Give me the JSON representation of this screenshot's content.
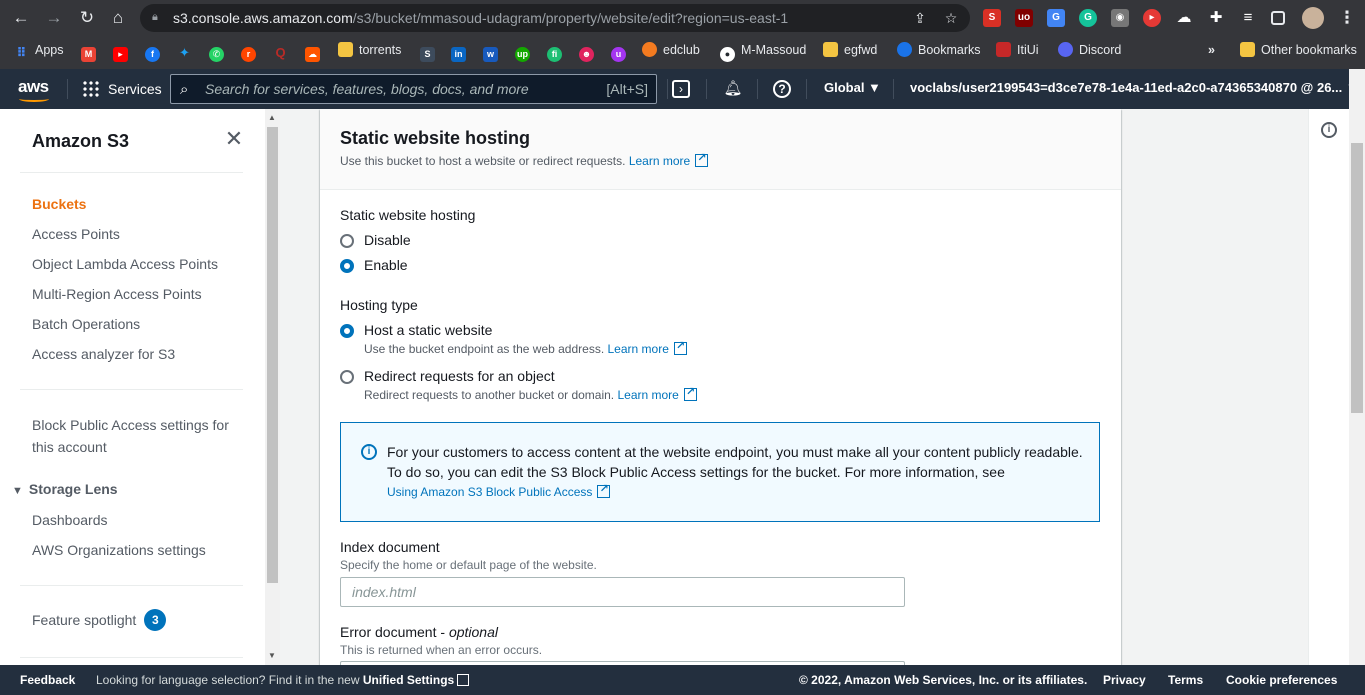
{
  "browser": {
    "url_host": "s3.console.aws.amazon.com",
    "url_path": "/s3/bucket/mmasoud-udagram/property/website/edit?region=us-east-1",
    "bookmarks": [
      {
        "label": "Apps",
        "color": "#4285f4"
      },
      {
        "label": "torrents",
        "color": "#f4c542"
      },
      {
        "label": "edclub",
        "color": "#f47b20"
      },
      {
        "label": "M-Massoud",
        "color": "#24292e"
      },
      {
        "label": "egfwd",
        "color": "#f4c542"
      },
      {
        "label": "Bookmarks",
        "color": "#1a73e8"
      },
      {
        "label": "ItiUi",
        "color": "#c62828"
      },
      {
        "label": "Discord",
        "color": "#5865f2"
      },
      {
        "label": "Other bookmarks",
        "color": "#f4c542"
      }
    ],
    "overflow": "»"
  },
  "awsnav": {
    "logo": "aws",
    "services": "Services",
    "search_placeholder": "Search for services, features, blogs, docs, and more",
    "search_shortcut": "[Alt+S]",
    "region": "Global ▼",
    "account": "voclabs/user2199543=d3ce7e78-1e4a-11ed-a2c0-a74365340870 @ 26... ▼"
  },
  "sidebar": {
    "title": "Amazon S3",
    "items": [
      "Buckets",
      "Access Points",
      "Object Lambda Access Points",
      "Multi-Region Access Points",
      "Batch Operations",
      "Access analyzer for S3"
    ],
    "block_public_line1": "Block Public Access settings for",
    "block_public_line2": "this account",
    "storage_lens": "Storage Lens",
    "storage_items": [
      "Dashboards",
      "AWS Organizations settings"
    ],
    "feature_spotlight": "Feature spotlight",
    "feature_count": "3"
  },
  "panel": {
    "title": "Static website hosting",
    "description": "Use this bucket to host a website or redirect requests.",
    "learn_more": "Learn more",
    "hosting_label": "Static website hosting",
    "hosting_options": [
      "Disable",
      "Enable"
    ],
    "hosting_selected": "Enable",
    "type_label": "Hosting type",
    "type_options": [
      {
        "label": "Host a static website",
        "desc": "Use the bucket endpoint as the web address."
      },
      {
        "label": "Redirect requests for an object",
        "desc": "Redirect requests to another bucket or domain."
      }
    ],
    "type_selected": "Host a static website",
    "info_message": "For your customers to access content at the website endpoint, you must make all your content publicly readable. To do so, you can edit the S3 Block Public Access settings for the bucket. For more information, see",
    "info_link": "Using Amazon S3 Block Public Access",
    "index_label": "Index document",
    "index_desc": "Specify the home or default page of the website.",
    "index_placeholder": "index.html",
    "error_label": "Error document -",
    "error_optional": "optional",
    "error_desc": "This is returned when an error occurs."
  },
  "footer": {
    "feedback": "Feedback",
    "lang_text": "Looking for language selection? Find it in the new",
    "lang_link": "Unified Settings",
    "copyright": "© 2022, Amazon Web Services, Inc. or its affiliates.",
    "privacy": "Privacy",
    "terms": "Terms",
    "cookies": "Cookie preferences"
  }
}
